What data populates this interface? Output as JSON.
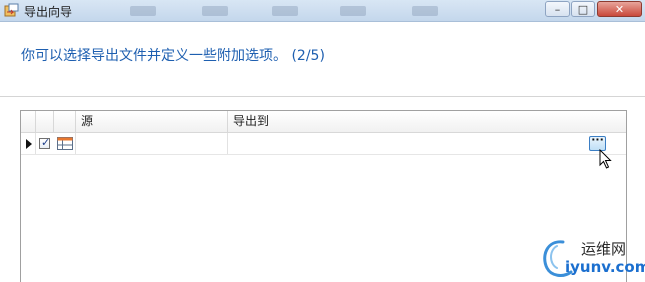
{
  "window": {
    "title": "导出向导",
    "icon": "export-wizard-icon",
    "minimize_glyph": "–",
    "maximize_glyph": "□",
    "close_glyph": "✕"
  },
  "wizard": {
    "subtitle": "你可以选择导出文件并定义一些附加选项。 (2/5)"
  },
  "grid": {
    "columns": [
      "",
      "",
      "",
      "源",
      "导出到"
    ],
    "rows": [
      {
        "selected": true,
        "checked": true,
        "source": "",
        "export_to": "",
        "browse_label": "···"
      }
    ]
  },
  "watermark": {
    "name": "运维网",
    "domain": "iyunv.com"
  },
  "colors": {
    "accent": "#1e5fb0",
    "watermark_blue": "#1b6fcf"
  }
}
